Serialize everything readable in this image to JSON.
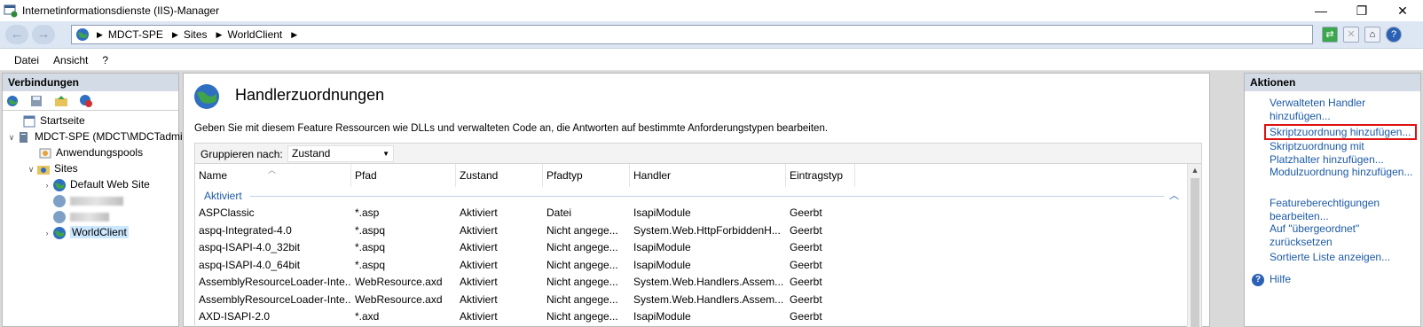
{
  "window": {
    "title": "Internetinformationsdienste (IIS)-Manager",
    "minimize": "—",
    "maximize": "❐",
    "close": "✕"
  },
  "address": {
    "back": "←",
    "forward": "→",
    "crumbs": [
      "MDCT-SPE",
      "Sites",
      "WorldClient"
    ],
    "separator": "▶"
  },
  "menu": {
    "items": [
      "Datei",
      "Ansicht",
      "?"
    ]
  },
  "connections": {
    "header": "Verbindungen",
    "tree": {
      "start": "Startseite",
      "server": "MDCT-SPE (MDCT\\MDCTadmin)",
      "apppools": "Anwendungspools",
      "sites": "Sites",
      "default_site": "Default Web Site",
      "worldclient": "WorldClient"
    }
  },
  "feature": {
    "title": "Handlerzuordnungen",
    "description": "Geben Sie mit diesem Feature Ressourcen wie DLLs und verwalteten Code an, die Antworten auf bestimmte Anforderungstypen bearbeiten.",
    "group_label": "Gruppieren nach:",
    "group_value": "Zustand",
    "columns": [
      "Name",
      "Pfad",
      "Zustand",
      "Pfadtyp",
      "Handler",
      "Eintragstyp"
    ],
    "group_name": "Aktiviert",
    "rows": [
      [
        "ASPClassic",
        "*.asp",
        "Aktiviert",
        "Datei",
        "IsapiModule",
        "Geerbt"
      ],
      [
        "aspq-Integrated-4.0",
        "*.aspq",
        "Aktiviert",
        "Nicht angege...",
        "System.Web.HttpForbiddenH...",
        "Geerbt"
      ],
      [
        "aspq-ISAPI-4.0_32bit",
        "*.aspq",
        "Aktiviert",
        "Nicht angege...",
        "IsapiModule",
        "Geerbt"
      ],
      [
        "aspq-ISAPI-4.0_64bit",
        "*.aspq",
        "Aktiviert",
        "Nicht angege...",
        "IsapiModule",
        "Geerbt"
      ],
      [
        "AssemblyResourceLoader-Inte...",
        "WebResource.axd",
        "Aktiviert",
        "Nicht angege...",
        "System.Web.Handlers.Assem...",
        "Geerbt"
      ],
      [
        "AssemblyResourceLoader-Inte...",
        "WebResource.axd",
        "Aktiviert",
        "Nicht angege...",
        "System.Web.Handlers.Assem...",
        "Geerbt"
      ],
      [
        "AXD-ISAPI-2.0",
        "*.axd",
        "Aktiviert",
        "Nicht angege...",
        "IsapiModule",
        "Geerbt"
      ]
    ]
  },
  "actions": {
    "header": "Aktionen",
    "items": [
      "Verwalteten Handler hinzufügen...",
      "Skriptzuordnung hinzufügen...",
      "Skriptzuordnung mit Platzhalter hinzufügen...",
      "Modulzuordnung hinzufügen...",
      "Featureberechtigungen bearbeiten...",
      "Auf \"übergeordnet\" zurücksetzen",
      "Sortierte Liste anzeigen...",
      "Hilfe"
    ],
    "help_glyph": "?"
  },
  "colors": {
    "link": "#1c5aa6",
    "highlight_box": "#e01010",
    "panel_header": "#d3dbe6"
  }
}
